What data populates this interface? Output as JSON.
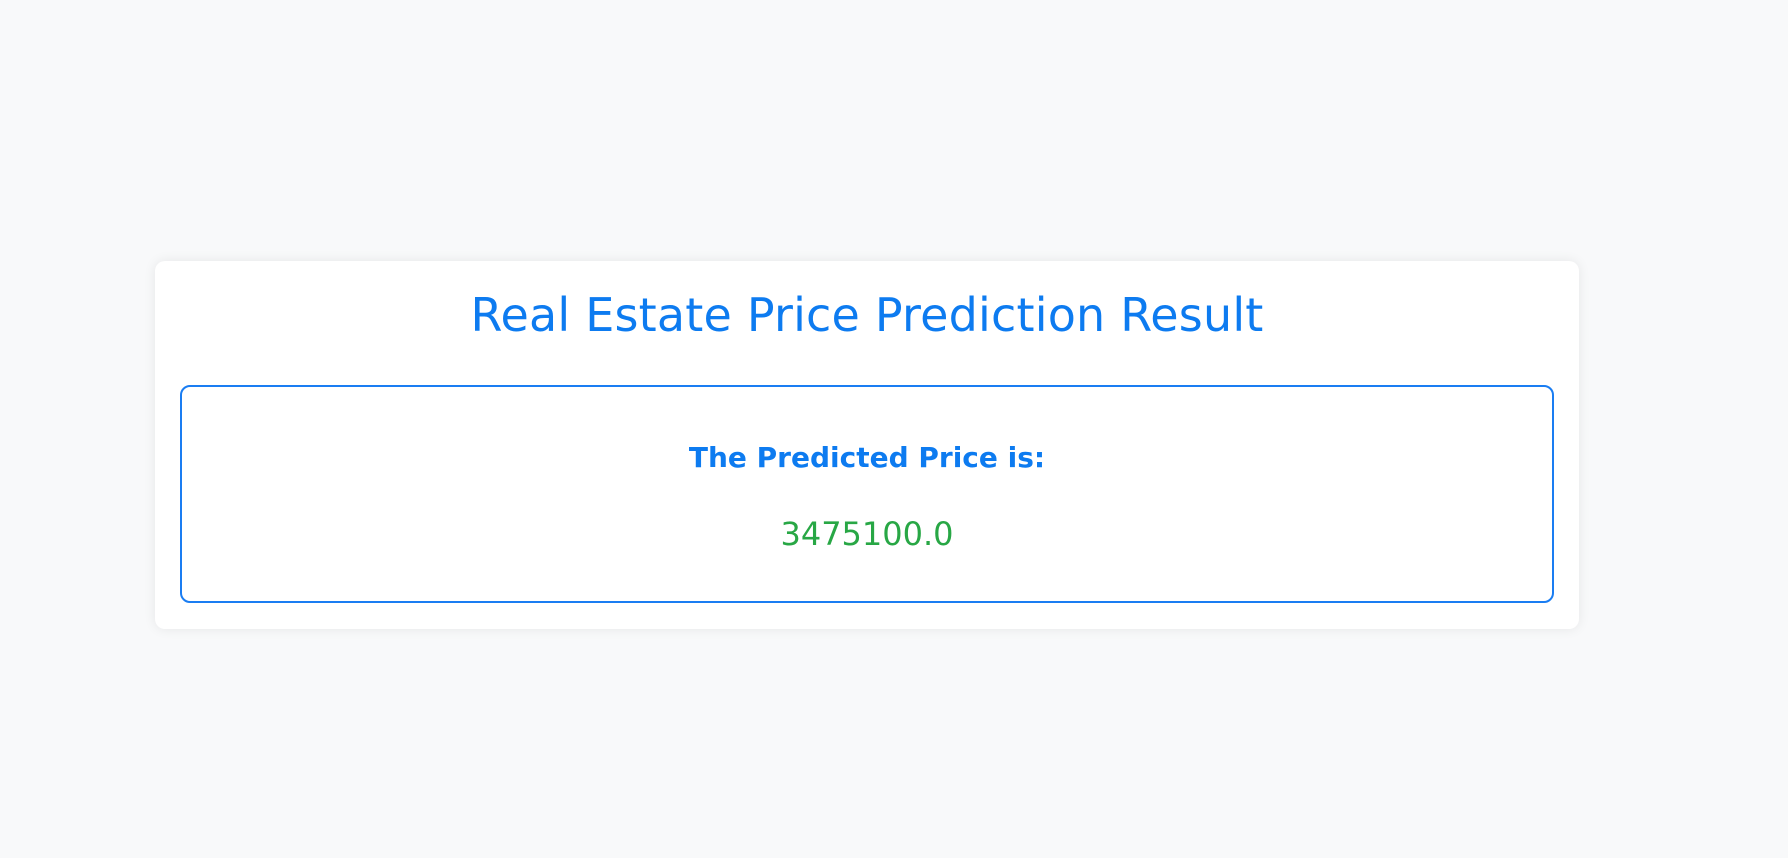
{
  "page": {
    "title": "Real Estate Price Prediction Result"
  },
  "result": {
    "label": "The Predicted Price is:",
    "value": "3475100.0"
  },
  "colors": {
    "background": "#f8f9fa",
    "accent": "#0d7bf0",
    "price": "#28a745",
    "card": "#ffffff"
  }
}
